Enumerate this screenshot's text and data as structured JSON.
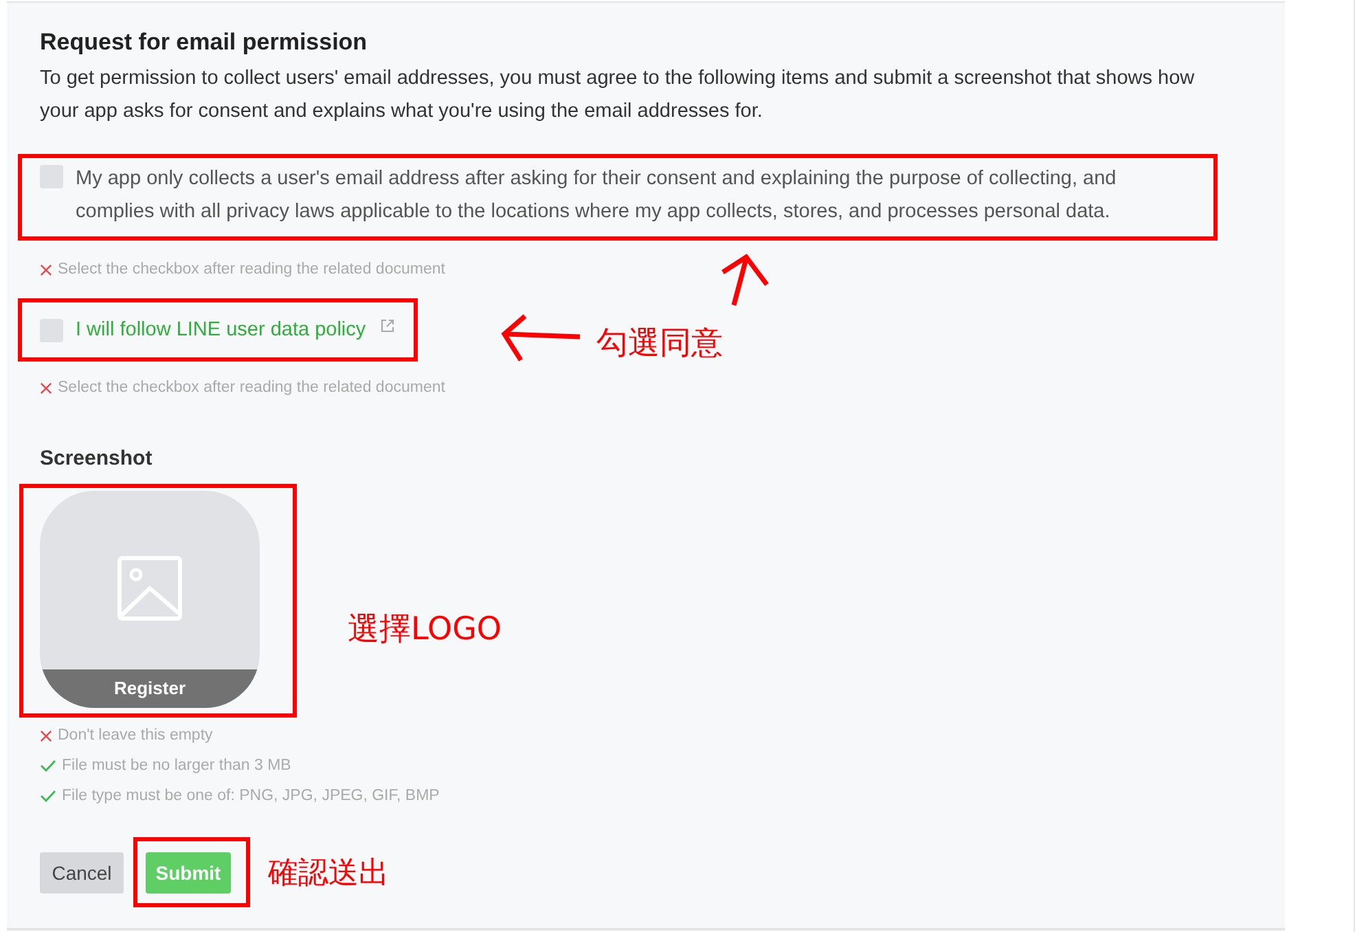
{
  "title": "Request for email permission",
  "description": "To get permission to collect users' email addresses, you must agree to the following items and submit a screenshot that shows how your app asks for consent and explains what you're using the email addresses for.",
  "consent_items": [
    {
      "kind": "plain",
      "label": "My app only collects a user's email address after asking for their consent and explaining the purpose of collecting, and complies with all privacy laws applicable to the locations where my app collects, stores, and processes personal data.",
      "checked": false,
      "highlighted": true,
      "hint": {
        "kind": "error",
        "text": "Select the checkbox after reading the related document"
      }
    },
    {
      "kind": "link",
      "label": "I will follow LINE user data policy",
      "checked": false,
      "highlighted": true,
      "hint": {
        "kind": "error",
        "text": "Select the checkbox after reading the related document"
      }
    }
  ],
  "screenshot": {
    "label": "Screenshot",
    "button": "Register",
    "highlighted": true,
    "hints": [
      {
        "kind": "error",
        "text": "Don't leave this empty"
      },
      {
        "kind": "ok",
        "text": "File must be no larger than 3 MB"
      },
      {
        "kind": "ok",
        "text": "File type must be one of: PNG, JPG, JPEG, GIF, BMP"
      }
    ]
  },
  "buttons": [
    {
      "kind": "secondary",
      "label": "Cancel",
      "highlighted": false
    },
    {
      "kind": "primary",
      "label": "Submit",
      "highlighted": true
    }
  ],
  "annotations": [
    {
      "text": "勾選同意"
    },
    {
      "text": "選擇LOGO"
    },
    {
      "text": "確認送出"
    }
  ]
}
